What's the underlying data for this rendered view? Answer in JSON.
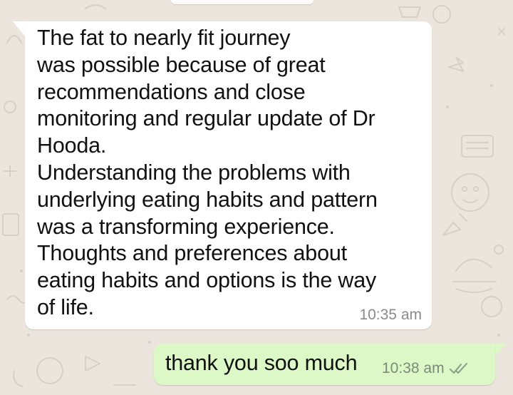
{
  "messages": [
    {
      "direction": "incoming",
      "text": "The fat to nearly fit journey\nwas possible because of great\nrecommendations and close\nmonitoring and regular update of Dr\nHooda.\nUnderstanding the problems with\nunderlying eating habits and pattern\nwas a transforming experience.\nThoughts and preferences about\neating habits and options is the way\nof life.",
      "time": "10:35 am"
    },
    {
      "direction": "outgoing",
      "text": "thank you soo much",
      "time": "10:38 am",
      "status_icon": "double-check-icon"
    }
  ],
  "colors": {
    "chat_background": "#ece5dd",
    "incoming_bubble": "#ffffff",
    "outgoing_bubble": "#dcf8c6",
    "timestamp": "#8a8a8a"
  }
}
